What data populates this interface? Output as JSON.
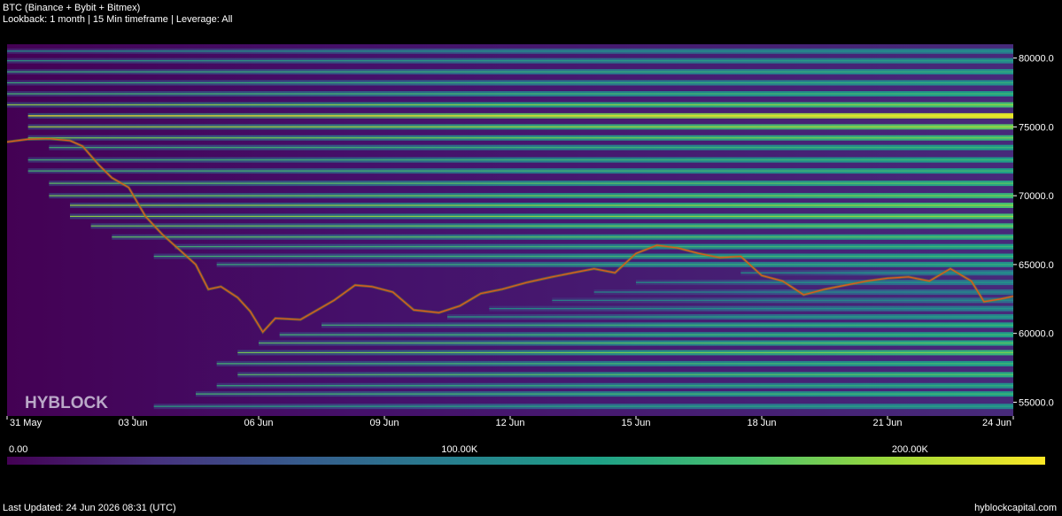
{
  "header": {
    "title": "BTC (Binance + Bybit + Bitmex)",
    "subtitle": "Lookback: 1 month | 15 Min timeframe | Leverage: All"
  },
  "watermark": "HYBLOCK",
  "footer": {
    "updated": "Last Updated: 24 Jun 2026 08:31 (UTC)",
    "site": "hyblockcapital.com"
  },
  "colorbar": {
    "labels": [
      {
        "value": 0,
        "text": "0.00"
      },
      {
        "value": 100000,
        "text": "100.00K"
      },
      {
        "value": 200000,
        "text": "200.00K"
      }
    ],
    "min": 0,
    "max": 230000
  },
  "chart_data": {
    "type": "heatmap",
    "ylim": [
      54000,
      81000
    ],
    "xlim": [
      0,
      24
    ],
    "yticks": [
      {
        "value": 55000,
        "label": "55000.0"
      },
      {
        "value": 60000,
        "label": "60000.0"
      },
      {
        "value": 65000,
        "label": "65000.0"
      },
      {
        "value": 70000,
        "label": "70000.0"
      },
      {
        "value": 75000,
        "label": "75000.0"
      },
      {
        "value": 80000,
        "label": "80000.0"
      }
    ],
    "xticks": [
      {
        "day": 0,
        "label": "31 May"
      },
      {
        "day": 3,
        "label": "03 Jun"
      },
      {
        "day": 6,
        "label": "06 Jun"
      },
      {
        "day": 9,
        "label": "09 Jun"
      },
      {
        "day": 12,
        "label": "12 Jun"
      },
      {
        "day": 15,
        "label": "15 Jun"
      },
      {
        "day": 18,
        "label": "18 Jun"
      },
      {
        "day": 21,
        "label": "21 Jun"
      },
      {
        "day": 24,
        "label": "24 Jun"
      }
    ],
    "colormap": [
      "#440154",
      "#46327e",
      "#365c8d",
      "#277f8e",
      "#1fa187",
      "#4ac16d",
      "#a0da39",
      "#fde725"
    ],
    "price_series": [
      [
        0,
        73900
      ],
      [
        0.5,
        74100
      ],
      [
        1,
        74150
      ],
      [
        1.5,
        74000
      ],
      [
        1.8,
        73600
      ],
      [
        2.2,
        72200
      ],
      [
        2.5,
        71300
      ],
      [
        2.9,
        70600
      ],
      [
        3.3,
        68500
      ],
      [
        3.7,
        67200
      ],
      [
        4.1,
        66100
      ],
      [
        4.5,
        65000
      ],
      [
        4.8,
        63200
      ],
      [
        5.1,
        63400
      ],
      [
        5.5,
        62600
      ],
      [
        5.8,
        61600
      ],
      [
        6.1,
        60100
      ],
      [
        6.4,
        61100
      ],
      [
        7.0,
        61000
      ],
      [
        7.4,
        61700
      ],
      [
        7.8,
        62400
      ],
      [
        8.3,
        63500
      ],
      [
        8.7,
        63400
      ],
      [
        9.2,
        63000
      ],
      [
        9.7,
        61700
      ],
      [
        10.3,
        61500
      ],
      [
        10.8,
        62000
      ],
      [
        11.3,
        62900
      ],
      [
        11.8,
        63200
      ],
      [
        12.4,
        63700
      ],
      [
        13.0,
        64100
      ],
      [
        13.5,
        64400
      ],
      [
        14.0,
        64700
      ],
      [
        14.5,
        64400
      ],
      [
        15.0,
        65800
      ],
      [
        15.5,
        66400
      ],
      [
        16.0,
        66200
      ],
      [
        16.5,
        65800
      ],
      [
        17.0,
        65500
      ],
      [
        17.5,
        65600
      ],
      [
        18.0,
        64200
      ],
      [
        18.5,
        63800
      ],
      [
        19.0,
        62800
      ],
      [
        19.5,
        63200
      ],
      [
        20.0,
        63500
      ],
      [
        20.5,
        63800
      ],
      [
        21.0,
        64000
      ],
      [
        21.5,
        64100
      ],
      [
        22.0,
        63800
      ],
      [
        22.5,
        64700
      ],
      [
        23.0,
        63800
      ],
      [
        23.3,
        62300
      ],
      [
        23.7,
        62500
      ],
      [
        24.0,
        62700
      ]
    ],
    "liquidation_levels": [
      {
        "price": 54700,
        "intensity": 0.45,
        "start": 3.5
      },
      {
        "price": 55600,
        "intensity": 0.55,
        "start": 4.5
      },
      {
        "price": 56200,
        "intensity": 0.5,
        "start": 5.0
      },
      {
        "price": 57000,
        "intensity": 0.6,
        "start": 5.5
      },
      {
        "price": 57800,
        "intensity": 0.55,
        "start": 5.0
      },
      {
        "price": 58600,
        "intensity": 0.65,
        "start": 5.5
      },
      {
        "price": 59300,
        "intensity": 0.6,
        "start": 6.0
      },
      {
        "price": 59900,
        "intensity": 0.55,
        "start": 6.5
      },
      {
        "price": 60600,
        "intensity": 0.55,
        "start": 7.5
      },
      {
        "price": 61200,
        "intensity": 0.45,
        "start": 10.5
      },
      {
        "price": 61800,
        "intensity": 0.4,
        "start": 11.5
      },
      {
        "price": 62400,
        "intensity": 0.35,
        "start": 13.0
      },
      {
        "price": 63000,
        "intensity": 0.35,
        "start": 14.0
      },
      {
        "price": 63700,
        "intensity": 0.4,
        "start": 15.0
      },
      {
        "price": 64400,
        "intensity": 0.4,
        "start": 17.5
      },
      {
        "price": 65000,
        "intensity": 0.5,
        "start": 5.0
      },
      {
        "price": 65600,
        "intensity": 0.55,
        "start": 3.5
      },
      {
        "price": 66300,
        "intensity": 0.55,
        "start": 4.0
      },
      {
        "price": 67000,
        "intensity": 0.6,
        "start": 2.5
      },
      {
        "price": 67800,
        "intensity": 0.65,
        "start": 2.0
      },
      {
        "price": 68500,
        "intensity": 0.7,
        "start": 1.5
      },
      {
        "price": 69300,
        "intensity": 0.7,
        "start": 1.5
      },
      {
        "price": 70000,
        "intensity": 0.65,
        "start": 1.0
      },
      {
        "price": 70900,
        "intensity": 0.6,
        "start": 1.0
      },
      {
        "price": 71800,
        "intensity": 0.55,
        "start": 0.5
      },
      {
        "price": 72600,
        "intensity": 0.55,
        "start": 0.5
      },
      {
        "price": 73500,
        "intensity": 0.55,
        "start": 1.0
      },
      {
        "price": 74200,
        "intensity": 0.65,
        "start": 0.5
      },
      {
        "price": 75000,
        "intensity": 0.75,
        "start": 0.5
      },
      {
        "price": 75800,
        "intensity": 0.95,
        "start": 0.5
      },
      {
        "price": 76600,
        "intensity": 0.7,
        "start": 0.0
      },
      {
        "price": 77400,
        "intensity": 0.55,
        "start": 0.0
      },
      {
        "price": 78200,
        "intensity": 0.5,
        "start": 0.0
      },
      {
        "price": 79000,
        "intensity": 0.5,
        "start": 0.0
      },
      {
        "price": 79800,
        "intensity": 0.45,
        "start": 0.0
      },
      {
        "price": 80500,
        "intensity": 0.4,
        "start": 0.0
      }
    ]
  }
}
